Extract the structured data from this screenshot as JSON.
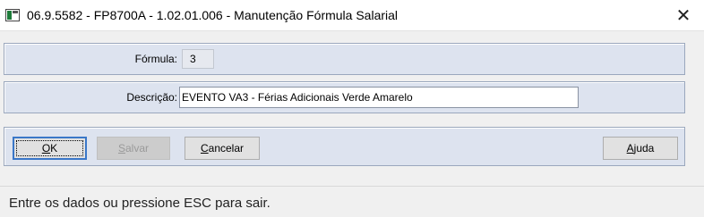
{
  "window": {
    "title": "06.9.5582 - FP8700A - 1.02.01.006 - Manutenção Fórmula Salarial",
    "close_glyph": "✕",
    "icon": "app-window-icon"
  },
  "form": {
    "formula_label": "Fórmula:",
    "formula_value": "3",
    "description_label": "Descrição:",
    "description_value": "EVENTO VA3 - Férias Adicionais Verde Amarelo"
  },
  "buttons": {
    "ok": {
      "prefix": "",
      "mnemonic": "O",
      "suffix": "K"
    },
    "save": {
      "prefix": "",
      "mnemonic": "S",
      "suffix": "alvar",
      "enabled": false
    },
    "cancel": {
      "prefix": "",
      "mnemonic": "C",
      "suffix": "ancelar"
    },
    "help": {
      "prefix": "",
      "mnemonic": "A",
      "suffix": "juda"
    }
  },
  "status": {
    "message": "Entre os dados ou pressione ESC para sair."
  },
  "colors": {
    "panel_bg": "#dde3ef",
    "panel_border": "#9aa7bd",
    "focus_border": "#3a77c8",
    "disabled_text": "#9a9a9a"
  }
}
